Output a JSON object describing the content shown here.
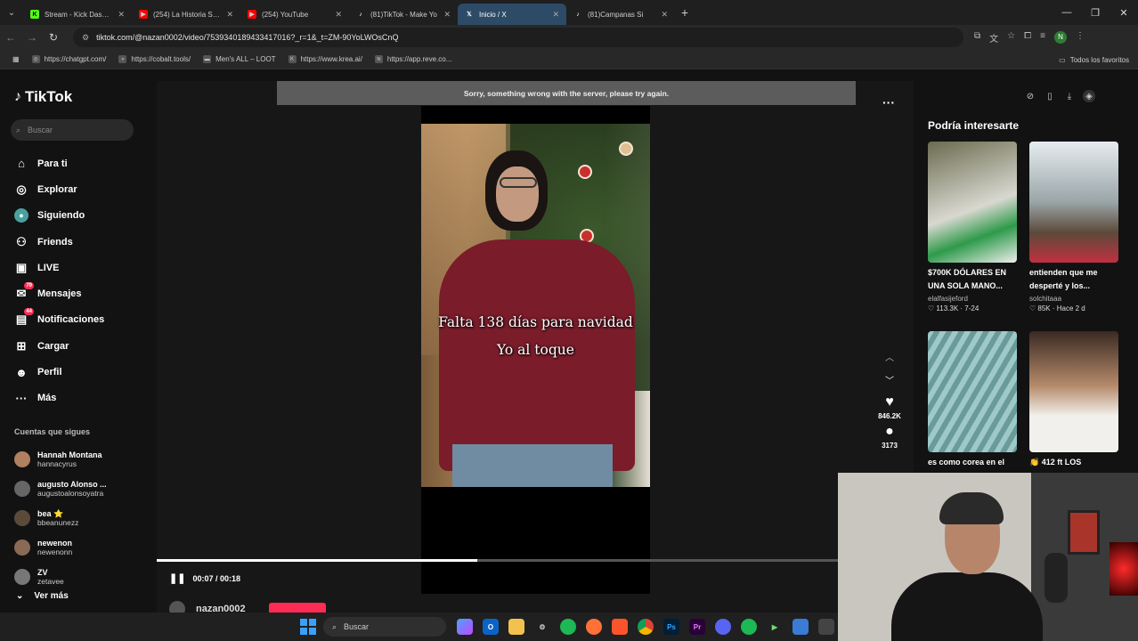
{
  "browser": {
    "tabs": [
      {
        "title": "Stream - Kick Dashbo",
        "icon": "kick-icon",
        "color": "#53fc18"
      },
      {
        "title": "(254) La Historia SEC",
        "icon": "youtube-icon",
        "color": "#ff0000"
      },
      {
        "title": "(254) YouTube",
        "icon": "youtube-icon",
        "color": "#ff0000"
      },
      {
        "title": "(81)TikTok - Make Yo",
        "icon": "tiktok-icon",
        "color": "#ffffff"
      },
      {
        "title": "Inicio / X",
        "icon": "x-icon",
        "color": "#ffffff",
        "active": true
      },
      {
        "title": "(81)Campanas Si",
        "icon": "tiktok-icon",
        "color": "#ffffff"
      }
    ],
    "url": "tiktok.com/@nazan0002/video/7539340189433417016?_r=1&_t=ZM-90YoLWOsCnQ",
    "profile_letter": "N",
    "bookmarks": [
      {
        "label": "https://chatgpt.com/",
        "icon": "chatgpt-icon"
      },
      {
        "label": "https://cobalt.tools/",
        "icon": "cobalt-icon"
      },
      {
        "label": "Men's ALL – LOOT",
        "icon": "loot-icon"
      },
      {
        "label": "https://www.krea.ai/",
        "icon": "krea-icon"
      },
      {
        "label": "https://app.reve.co...",
        "icon": "reve-icon"
      }
    ],
    "bookmarks_right": "Todos los favoritos"
  },
  "tiktok": {
    "logo": "TikTok",
    "search_placeholder": "Buscar",
    "nav": [
      {
        "label": "Para ti",
        "icon": "home-icon"
      },
      {
        "label": "Explorar",
        "icon": "compass-icon"
      },
      {
        "label": "Siguiendo",
        "icon": "following-icon"
      },
      {
        "label": "Friends",
        "icon": "friends-icon"
      },
      {
        "label": "LIVE",
        "icon": "live-icon"
      },
      {
        "label": "Mensajes",
        "icon": "messages-icon",
        "badge": "79"
      },
      {
        "label": "Notificaciones",
        "icon": "notifications-icon",
        "badge": "44"
      },
      {
        "label": "Cargar",
        "icon": "upload-icon"
      },
      {
        "label": "Perfil",
        "icon": "profile-icon"
      },
      {
        "label": "Más",
        "icon": "more-icon"
      }
    ],
    "following_title": "Cuentas que sigues",
    "following": [
      {
        "name": "Hannah Montana",
        "user": "hannacyrus"
      },
      {
        "name": "augusto Alonso ...",
        "user": "augustoalonsoyatra"
      },
      {
        "name": "bea ⭐",
        "user": "bbeanunezz"
      },
      {
        "name": "newenon",
        "user": "newenonn"
      },
      {
        "name": "ZV",
        "user": "zetavee"
      }
    ],
    "see_more": "Ver más",
    "error_message": "Sorry, something wrong with the server, please try again.",
    "caption_line1": "Falta 138 días para navidad",
    "caption_line2": "Yo al toque",
    "time": "00:07 / 00:18",
    "progress": 0.47,
    "author": "nazan0002",
    "likes": "846.2K",
    "comments": "3173",
    "right_title": "Podría interesarte",
    "recommended": [
      {
        "title_line1": "$700K DÓLARES EN",
        "title_line2": "UNA SOLA MANO...",
        "user": "elalfasijeford",
        "meta": "♡ 113.3K · 7-24"
      },
      {
        "title_line1": "entienden que me",
        "title_line2": "desperté y los...",
        "user": "solchitaaa",
        "meta": "♡ 85K · Hace 2 d"
      },
      {
        "title_line1": "es como corea en el",
        "title_line2": "",
        "user": "",
        "meta": ""
      },
      {
        "title_line1": "👏 412 ft LOS",
        "title_line2": "",
        "user": "",
        "meta": ""
      }
    ]
  },
  "taskbar": {
    "search_placeholder": "Buscar"
  }
}
